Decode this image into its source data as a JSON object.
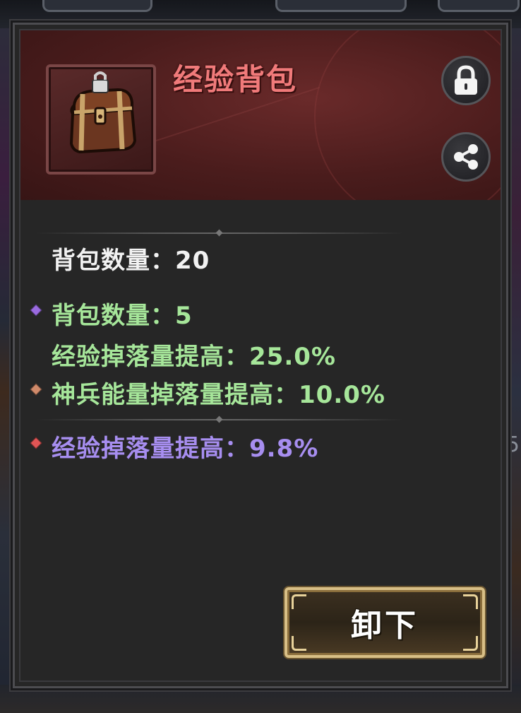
{
  "item": {
    "name": "经验背包",
    "icon": "treasure-chest-icon",
    "locked": true
  },
  "header_buttons": {
    "lock_icon": "lock-icon",
    "share_icon": "share-icon"
  },
  "base_stat": "背包数量：20",
  "bonus_stats": [
    {
      "text": "背包数量：5",
      "color": "#a6e69a"
    },
    {
      "text": "经验掉落量提高：25.0%",
      "color": "#a6e69a"
    },
    {
      "text": "神兵能量掉落量提高：10.0%",
      "color": "#a6e69a"
    }
  ],
  "special_stat": {
    "text": "经验掉落量提高：9.8%",
    "color": "#a78ef0"
  },
  "action": {
    "unload_label": "卸下"
  },
  "background": {
    "side_number": "5"
  },
  "colors": {
    "title": "#f07a7a",
    "header_bg": "#4a1c1c",
    "panel_bg": "#262626",
    "button_border": "#d8bf86"
  }
}
